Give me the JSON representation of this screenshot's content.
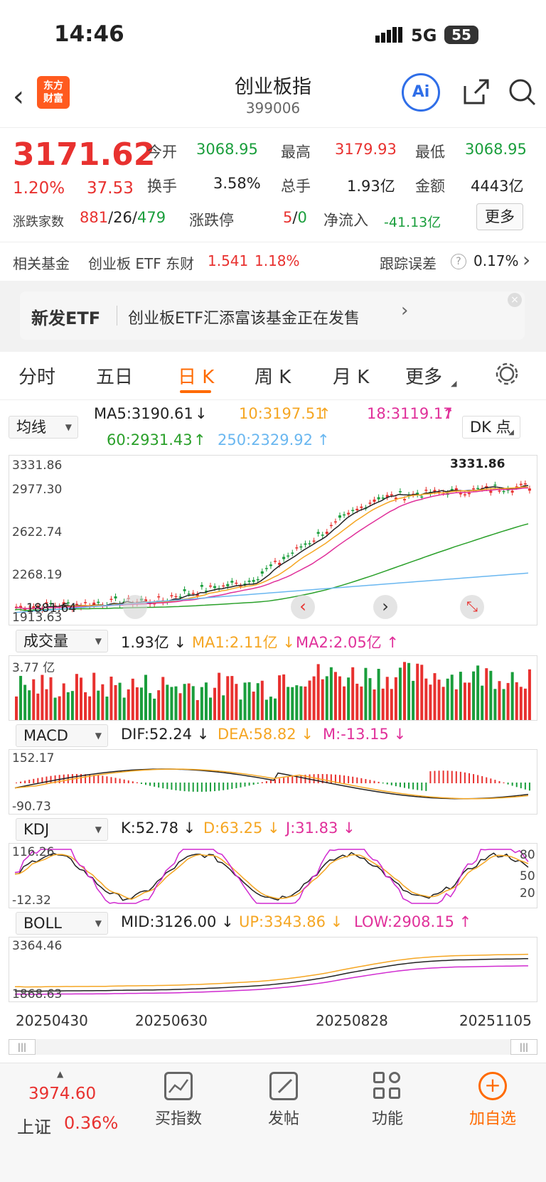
{
  "status_bar": {
    "time": "14:46",
    "network": "5G",
    "battery": "55"
  },
  "header": {
    "title": "创业板指",
    "code": "399006",
    "logo_text": "东方\n财富",
    "ai_label": "Ai"
  },
  "quote": {
    "price": "3171.62",
    "change_pct": "1.20%",
    "change": "37.53",
    "open_label": "今开",
    "open": "3068.95",
    "high_label": "最高",
    "high": "3179.93",
    "low_label": "最低",
    "low": "3068.95",
    "turnover_label": "换手",
    "turnover": "3.58%",
    "volume_label": "总手",
    "volume": "1.93亿",
    "amount_label": "金额",
    "amount": "4443亿",
    "breadth_label": "涨跌家数",
    "up_count": "881",
    "flat_count": "26",
    "down_count": "479",
    "limit_label": "涨跌停",
    "limit_up": "5",
    "limit_down": "0",
    "inflow_label": "净流入",
    "inflow": "-41.13亿",
    "more_button": "更多"
  },
  "fund": {
    "label": "相关基金",
    "name": "创业板 ETF 东财",
    "price": "1.541",
    "pct": "1.18%",
    "track_label": "跟踪误差",
    "track_value": "0.17%"
  },
  "banner": {
    "tag": "新发ETF",
    "text": "创业板ETF汇添富该基金正在发售"
  },
  "tabs": [
    "分时",
    "五日",
    "日 K",
    "周 K",
    "月 K",
    "更多"
  ],
  "ma": {
    "selector": "均线",
    "ma5": "MA5:3190.61",
    "ma10": "10:3197.51",
    "ma18": "18:3119.17",
    "ma60": "60:2931.43",
    "ma250": "250:2329.92",
    "dk_button": "DK 点"
  },
  "price_panel": {
    "y_ticks": [
      "3331.86",
      "2977.30",
      "2622.74",
      "2268.19",
      "1913.63"
    ],
    "high_marker": "3331.86",
    "low_marker": "1881.64"
  },
  "volume": {
    "selector": "成交量",
    "value": "1.93亿",
    "ma1": "MA1:2.11亿",
    "ma2": "MA2:2.05亿",
    "y_max": "3.77 亿"
  },
  "macd": {
    "selector": "MACD",
    "dif": "DIF:52.24",
    "dea": "DEA:58.82",
    "m": "M:-13.15",
    "y_max": "152.17",
    "y_min": "-90.73"
  },
  "kdj": {
    "selector": "KDJ",
    "k": "K:52.78",
    "d": "D:63.25",
    "j": "J:31.83",
    "y_max": "116.26",
    "y_min": "-12.32",
    "levels": [
      "80",
      "50",
      "20"
    ]
  },
  "boll": {
    "selector": "BOLL",
    "mid": "MID:3126.00",
    "up": "UP:3343.86",
    "low": "LOW:2908.15",
    "y_max": "3364.46",
    "y_min": "1868.63"
  },
  "dates": [
    "20250430",
    "20250630",
    "20250828",
    "20251105"
  ],
  "index_quote": {
    "value": "3974.60",
    "name": "上证",
    "pct": "0.36%"
  },
  "bottom_nav": [
    "买指数",
    "发帖",
    "功能",
    "加自选"
  ],
  "colors": {
    "up": "#e8312f",
    "down": "#1a9e3c",
    "ma5": "#222222",
    "ma10": "#f5a623",
    "ma18": "#e0309a",
    "ma60": "#2aa02a",
    "ma250": "#6ab7f0",
    "accent": "#ff6a00"
  }
}
